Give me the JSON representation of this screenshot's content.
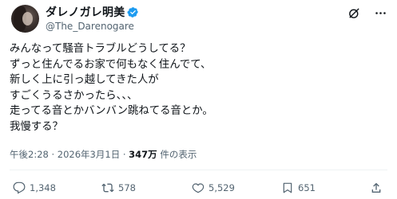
{
  "author": {
    "display_name": "ダレノガレ明美",
    "handle": "@The_Darenogare"
  },
  "tweet": {
    "line1": "みんなって騒音トラブルどうしてる？",
    "line2": "ずっと住んでるお家で何もなく住んでて、",
    "line3": "新しく上に引っ越してきた人が",
    "line4": "すごくうるさかったら、、、",
    "line5": "走ってる音とかバンバン跳ねてる音とか。",
    "line6": "我慢する？"
  },
  "meta": {
    "timestamp": "午後2:28 · 2026年3月1日 · ",
    "views_count": "347万",
    "views_label": " 件の表示"
  },
  "actions": {
    "replies": "1,348",
    "retweets": "578",
    "likes": "5,529",
    "bookmarks": "651"
  },
  "icons": {
    "verified": "verified-badge-icon",
    "grok": "grok-icon",
    "more": "more-options-icon",
    "reply": "reply-icon",
    "retweet": "retweet-icon",
    "like": "heart-icon",
    "bookmark": "bookmark-icon",
    "share": "share-icon"
  },
  "colors": {
    "verified_blue": "#1d9bf0",
    "text_primary": "#0f1419",
    "text_secondary": "#536471"
  }
}
